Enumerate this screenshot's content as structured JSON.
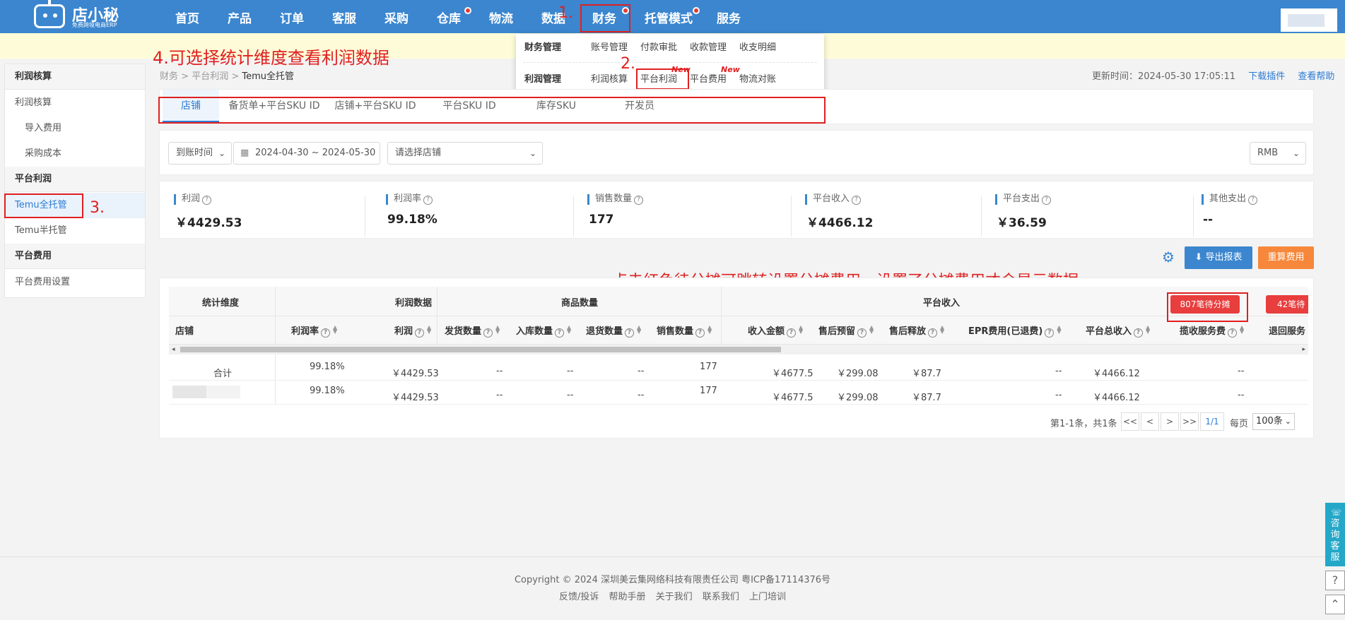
{
  "app": {
    "logo_name": "店小秘",
    "logo_sub": "免费跨境电商ERP"
  },
  "nav": {
    "items": [
      "首页",
      "产品",
      "订单",
      "客服",
      "采购",
      "仓库",
      "物流",
      "数据",
      "财务",
      "托管模式",
      "服务"
    ]
  },
  "annotations": {
    "a1": "1.",
    "a2": "2.",
    "a3": "3.",
    "a4": "4.可选择统计维度查看利润数据",
    "a5": "点击红色待分摊可跳转设置分摊费用，设置了分摊费用才会显示数据"
  },
  "dropdown": {
    "row1_head": "财务管理",
    "row1": [
      "账号管理",
      "付款审批",
      "收款管理",
      "收支明细"
    ],
    "row2_head": "利润管理",
    "row2": [
      "利润核算",
      "平台利润",
      "平台费用",
      "物流对账"
    ],
    "new_tag": "New"
  },
  "sidebar": {
    "g1": "利润核算",
    "i1": "利润核算",
    "i2": "导入费用",
    "i3": "采购成本",
    "g2": "平台利润",
    "i4": "Temu全托管",
    "i5": "Temu半托管",
    "g3": "平台费用",
    "i6": "平台费用设置"
  },
  "breadcrumb": {
    "b1": "财务",
    "sep": ">",
    "b2": "平台利润",
    "b3": "Temu全托管"
  },
  "header_right": {
    "update_time": "更新时间：2024-05-30 17:05:11",
    "download_plugin": "下载插件",
    "help": "查看帮助"
  },
  "tabs": [
    "店铺",
    "备货单+平台SKU ID",
    "店铺+平台SKU ID",
    "平台SKU ID",
    "库存SKU",
    "开发员"
  ],
  "filters": {
    "time_type": "到账时间",
    "date_range": "2024-04-30 ~ 2024-05-30",
    "shop_placeholder": "请选择店铺",
    "currency": "RMB"
  },
  "stats": [
    {
      "label": "利润",
      "value": "￥4429.53"
    },
    {
      "label": "利润率",
      "value": "99.18%"
    },
    {
      "label": "销售数量",
      "value": "177"
    },
    {
      "label": "平台收入",
      "value": "￥4466.12"
    },
    {
      "label": "平台支出",
      "value": "￥36.59"
    },
    {
      "label": "其他支出",
      "value": "--"
    }
  ],
  "actions": {
    "export": "导出报表",
    "recalc": "重算费用"
  },
  "table": {
    "groups": [
      "统计维度",
      "利润数据",
      "商品数量",
      "平台收入"
    ],
    "columns": [
      "店铺",
      "利润率",
      "利润",
      "发货数量",
      "入库数量",
      "退货数量",
      "销售数量",
      "收入金额",
      "售后预留",
      "售后释放",
      "EPR费用(已退费)",
      "平台总收入",
      "揽收服务费",
      "退回服务"
    ],
    "badge1": "807笔待分摊",
    "badge2": "42笔待",
    "rows": [
      [
        "合计",
        "99.18%",
        "￥4429.53",
        "--",
        "--",
        "--",
        "177",
        "￥4677.5",
        "￥299.08",
        "￥87.7",
        "--",
        "￥4466.12",
        "--"
      ],
      [
        "",
        "99.18%",
        "￥4429.53",
        "--",
        "--",
        "--",
        "177",
        "￥4677.5",
        "￥299.08",
        "￥87.7",
        "--",
        "￥4466.12",
        "--"
      ]
    ]
  },
  "pagination": {
    "summary": "第1-1条，共1条",
    "first": "<<",
    "prev": "<",
    "next": ">",
    "last": ">>",
    "current": "1/1",
    "per_page_label": "每页",
    "per_page": "100条"
  },
  "footer": {
    "copyright": "Copyright © 2024 深圳美云集网络科技有限责任公司  粤ICP备17114376号",
    "links": [
      "反馈/投诉",
      "帮助手册",
      "关于我们",
      "联系我们",
      "上门培训"
    ]
  },
  "widget": {
    "consult": "咨询客服"
  },
  "colors": {
    "nav_bg": "#3b86cf",
    "accent": "#2b7bd4",
    "annotation": "#e02020",
    "recalc": "#f7873a"
  }
}
